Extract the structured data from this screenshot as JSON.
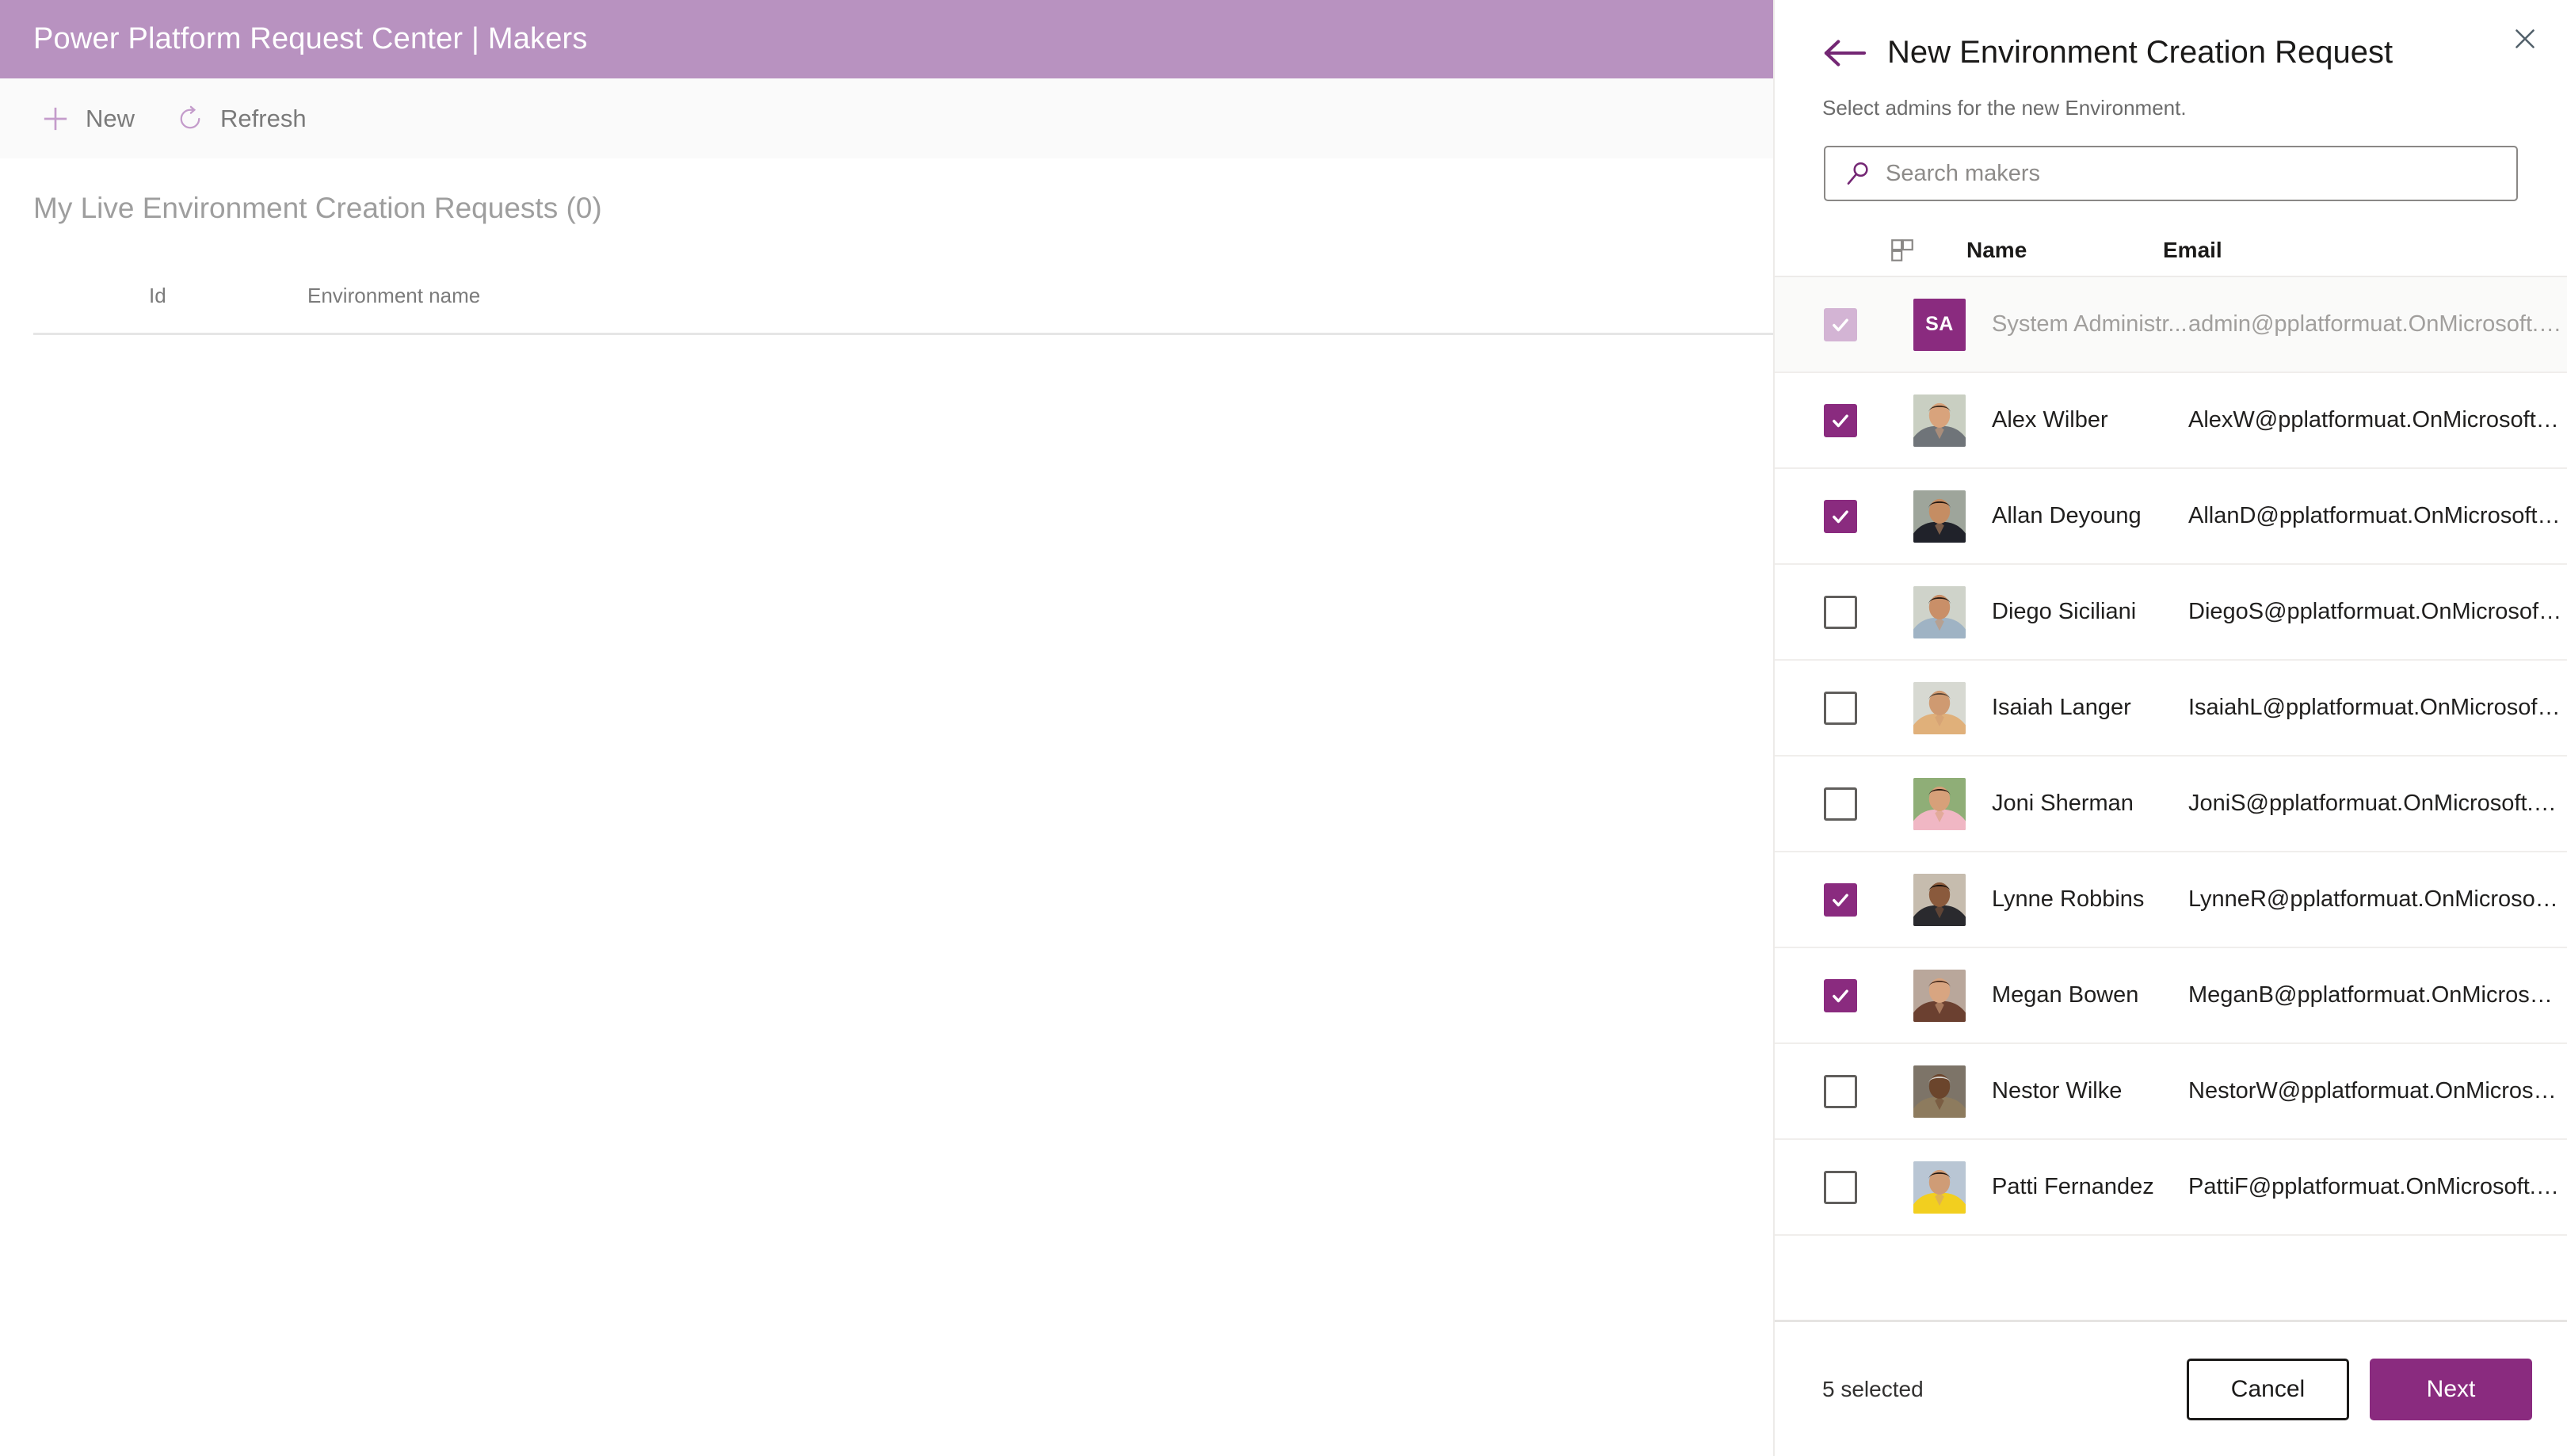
{
  "app": {
    "header_title": "Power Platform Request Center | Makers",
    "header_bg": "#b892c0",
    "toolbar": [
      {
        "label": "New",
        "icon": "plus-icon"
      },
      {
        "label": "Refresh",
        "icon": "refresh-icon"
      }
    ],
    "list_title": "My Live Environment Creation Requests (0)",
    "grid_columns": [
      "Id",
      "Environment name"
    ]
  },
  "panel": {
    "title": "New Environment Creation Request",
    "subtitle": "Select admins for the new Environment.",
    "back_icon": "back-arrow-icon",
    "close_icon": "close-icon",
    "accent": "#8a2b7f",
    "search": {
      "placeholder": "Search makers",
      "value": "",
      "icon": "search-icon"
    },
    "list_header": {
      "select_all_icon": "select-all-grid-icon",
      "name": "Name",
      "email": "Email"
    },
    "rows": [
      {
        "name": "System Administr...",
        "email": "admin@pplatformuat.OnMicrosoft.co...",
        "checked": true,
        "disabled": true,
        "avatar_type": "initials",
        "initials": "SA"
      },
      {
        "name": "Alex Wilber",
        "email": "AlexW@pplatformuat.OnMicrosoft.c...",
        "checked": true,
        "disabled": false,
        "avatar_type": "photo",
        "photo": "alex"
      },
      {
        "name": "Allan Deyoung",
        "email": "AllanD@pplatformuat.OnMicrosoft.c...",
        "checked": true,
        "disabled": false,
        "avatar_type": "photo",
        "photo": "allan"
      },
      {
        "name": "Diego Siciliani",
        "email": "DiegoS@pplatformuat.OnMicrosoft.c...",
        "checked": false,
        "disabled": false,
        "avatar_type": "photo",
        "photo": "diego"
      },
      {
        "name": "Isaiah Langer",
        "email": "IsaiahL@pplatformuat.OnMicrosoft.c...",
        "checked": false,
        "disabled": false,
        "avatar_type": "photo",
        "photo": "isaiah"
      },
      {
        "name": "Joni Sherman",
        "email": "JoniS@pplatformuat.OnMicrosoft.com",
        "checked": false,
        "disabled": false,
        "avatar_type": "photo",
        "photo": "joni"
      },
      {
        "name": "Lynne Robbins",
        "email": "LynneR@pplatformuat.OnMicrosoft.c...",
        "checked": true,
        "disabled": false,
        "avatar_type": "photo",
        "photo": "lynne"
      },
      {
        "name": "Megan Bowen",
        "email": "MeganB@pplatformuat.OnMicrosoft....",
        "checked": true,
        "disabled": false,
        "avatar_type": "photo",
        "photo": "megan"
      },
      {
        "name": "Nestor Wilke",
        "email": "NestorW@pplatformuat.OnMicrosoft...",
        "checked": false,
        "disabled": false,
        "avatar_type": "photo",
        "photo": "nestor"
      },
      {
        "name": "Patti Fernandez",
        "email": "PattiF@pplatformuat.OnMicrosoft.com",
        "checked": false,
        "disabled": false,
        "avatar_type": "photo",
        "photo": "patti"
      }
    ],
    "footer": {
      "selected_text": "5 selected",
      "cancel_label": "Cancel",
      "next_label": "Next"
    }
  }
}
